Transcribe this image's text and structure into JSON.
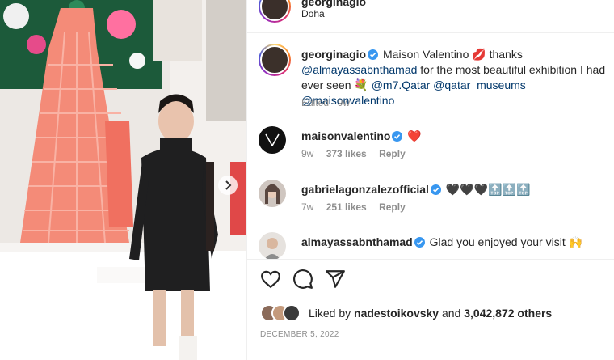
{
  "post": {
    "author": "georginagio",
    "location": "Doha",
    "caption": {
      "username": "georginagio",
      "text_before_mentions": "Maison Valentino 💋 thanks",
      "mention1": "@almayassabnthamad",
      "text_after_mention1": "for the most beautiful exhibition I had ever seen 💐",
      "mention2": "@m7.Qatar",
      "mention3": "@qatar_museums",
      "mention4": "@maisonvalentino",
      "edited": "Edited",
      "sep": "·",
      "age": "9w"
    },
    "comments": [
      {
        "username": "maisonvalentino",
        "text": "❤️",
        "age": "9w",
        "likes": "373 likes",
        "reply": "Reply"
      },
      {
        "username": "gabrielagonzalezofficial",
        "text": "🖤🖤🖤🔝🔝🔝",
        "age": "7w",
        "likes": "251 likes",
        "reply": "Reply"
      },
      {
        "username": "almayassabnthamad",
        "text": "Glad you enjoyed your visit 🙌",
        "age": "",
        "likes": "",
        "reply": ""
      }
    ],
    "liked_by": {
      "prefix": "Liked by",
      "user": "nadestoikovsky",
      "and": "and",
      "count": "3,042,872 others"
    },
    "date": "DECEMBER 5, 2022"
  },
  "icons": {
    "like": "heart-icon",
    "comment": "comment-icon",
    "share": "share-icon",
    "next": "chevron-right-icon",
    "verified": "verified-badge-icon"
  },
  "colors": {
    "verified": "#3897f0",
    "link": "#00376b",
    "muted": "#8e8e8e",
    "heart": "#ed4956"
  }
}
